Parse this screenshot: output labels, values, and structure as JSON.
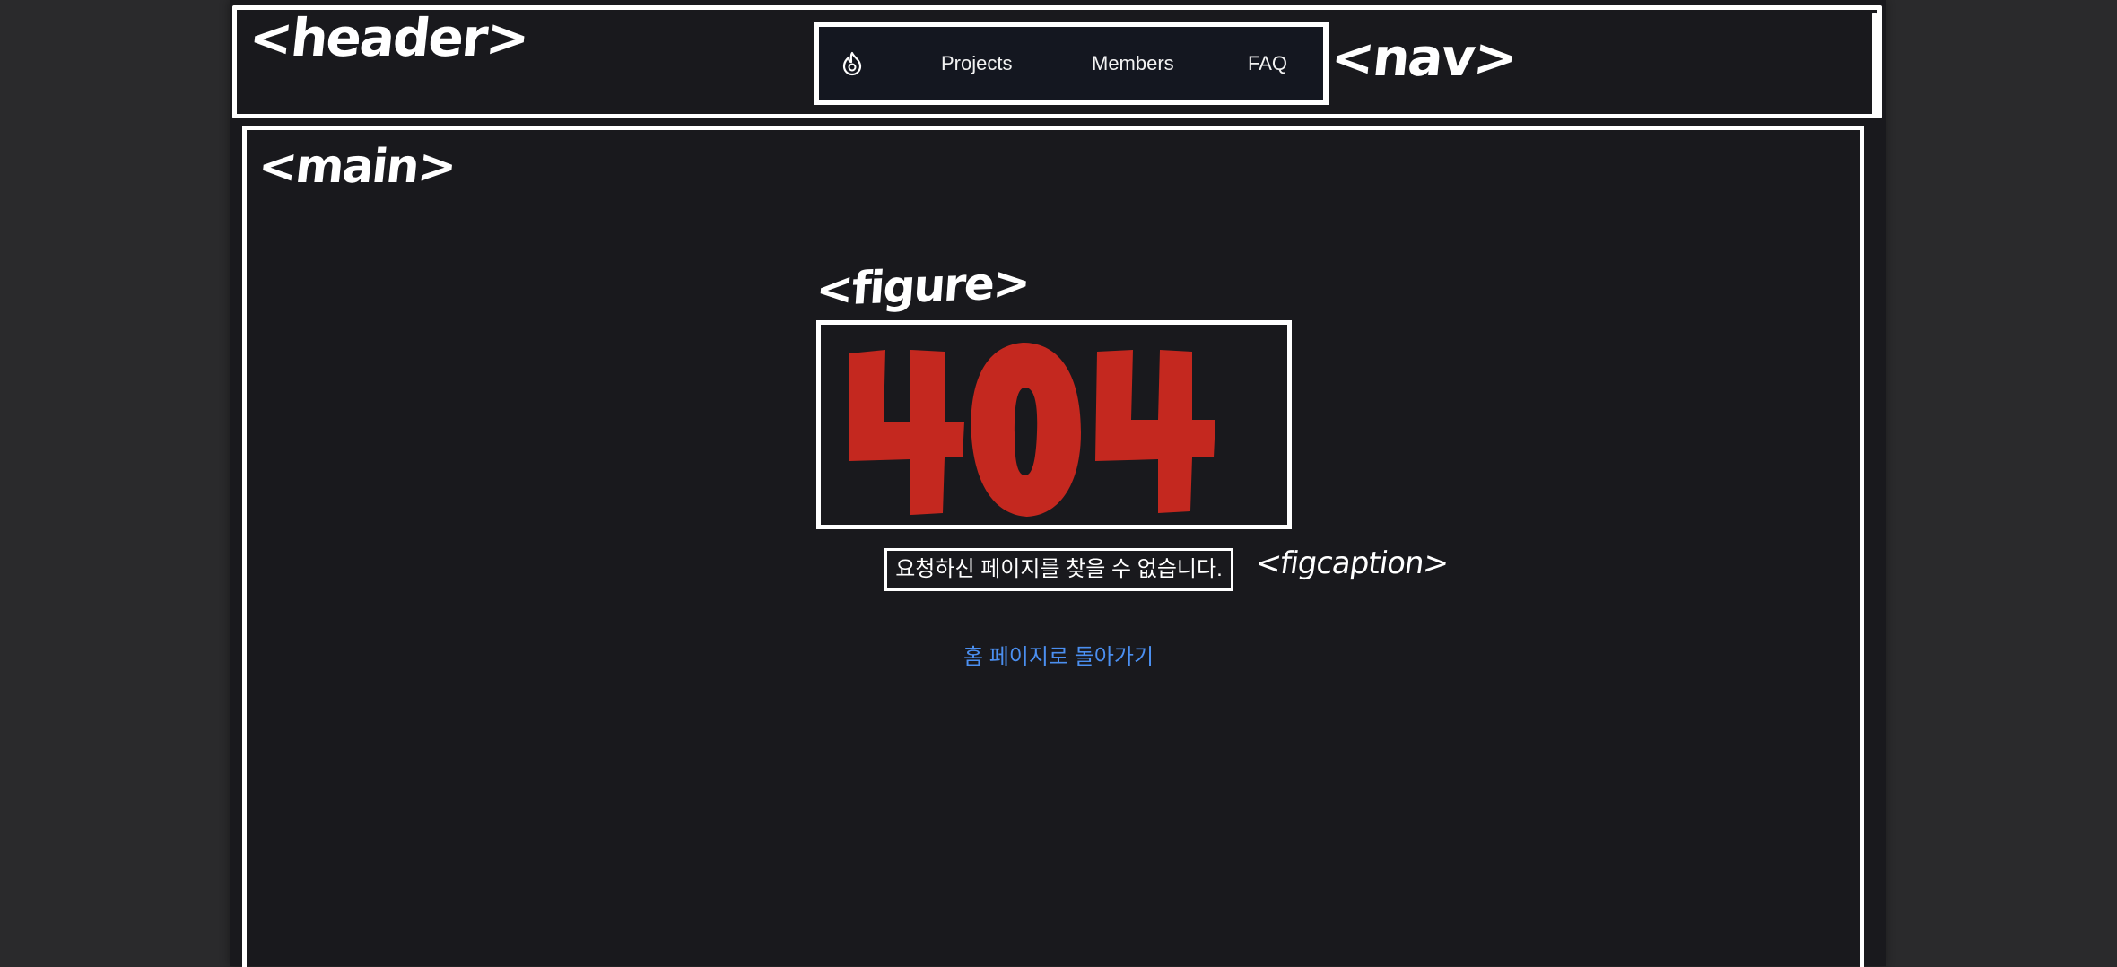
{
  "annotations": {
    "header": "<header>",
    "nav": "<nav>",
    "main": "<main>",
    "figure": "<figure>",
    "figcaption": "<figcaption>"
  },
  "nav": {
    "logo_icon": "flame-logo-icon",
    "links": [
      {
        "label": "Projects"
      },
      {
        "label": "Members"
      },
      {
        "label": "FAQ"
      }
    ]
  },
  "figure": {
    "image_text": "404",
    "image_color": "#c4281f",
    "caption": "요청하신 페이지를 찾을 수 없습니다."
  },
  "home_link": {
    "label": "홈 페이지로 돌아가기",
    "color": "#4b8ff0"
  }
}
